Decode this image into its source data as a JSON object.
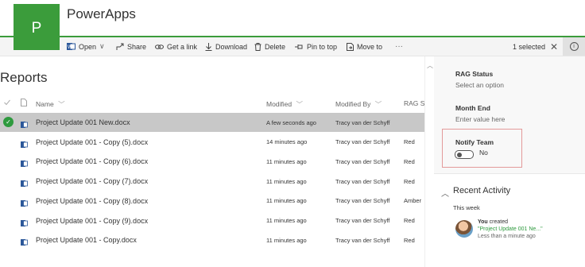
{
  "app": {
    "logo_letter": "P",
    "title": "PowerApps"
  },
  "commands": [
    {
      "label": "Open",
      "icon": "word-icon",
      "chevron": "∨"
    },
    {
      "label": "Share",
      "icon": "share-icon"
    },
    {
      "label": "Get a link",
      "icon": "link-icon"
    },
    {
      "label": "Download",
      "icon": "download-icon"
    },
    {
      "label": "Delete",
      "icon": "delete-icon"
    },
    {
      "label": "Pin to top",
      "icon": "pin-icon"
    },
    {
      "label": "Move to",
      "icon": "move-icon"
    }
  ],
  "more_label": "···",
  "selection": {
    "text": "1 selected",
    "close": "✕"
  },
  "library": {
    "title": "Reports"
  },
  "columns": {
    "name": "Name",
    "modified": "Modified",
    "modified_by": "Modified By",
    "rag": "RAG Sta"
  },
  "rows": [
    {
      "name": "Project Update 001 New.docx",
      "modified": "A few seconds ago",
      "modified_by": "Tracy van der Schyff",
      "rag": "",
      "selected": true
    },
    {
      "name": "Project Update 001 - Copy (5).docx",
      "modified": "14 minutes ago",
      "modified_by": "Tracy van der Schyff",
      "rag": "Red",
      "selected": false
    },
    {
      "name": "Project Update 001 - Copy (6).docx",
      "modified": "11 minutes ago",
      "modified_by": "Tracy van der Schyff",
      "rag": "Red",
      "selected": false
    },
    {
      "name": "Project Update 001 - Copy (7).docx",
      "modified": "11 minutes ago",
      "modified_by": "Tracy van der Schyff",
      "rag": "Red",
      "selected": false
    },
    {
      "name": "Project Update 001 - Copy (8).docx",
      "modified": "11 minutes ago",
      "modified_by": "Tracy van der Schyff",
      "rag": "Amber",
      "selected": false
    },
    {
      "name": "Project Update 001 - Copy (9).docx",
      "modified": "11 minutes ago",
      "modified_by": "Tracy van der Schyff",
      "rag": "Red",
      "selected": false
    },
    {
      "name": "Project Update 001 - Copy.docx",
      "modified": "11 minutes ago",
      "modified_by": "Tracy van der Schyff",
      "rag": "Red",
      "selected": false
    }
  ],
  "details": {
    "rag_label": "RAG Status",
    "rag_value": "Select an option",
    "month_label": "Month End",
    "month_value": "Enter value here",
    "notify_label": "Notify Team",
    "notify_value": "No"
  },
  "activity": {
    "title": "Recent Activity",
    "period": "This week",
    "actor": "You",
    "action": " created",
    "item": "\"Project Update 001 Ne...\"",
    "time": "Less than a minute ago"
  },
  "colors": {
    "brand": "#3b9c3b",
    "selected_row": "#c8c8c8",
    "highlight_border": "#e39a9a"
  }
}
